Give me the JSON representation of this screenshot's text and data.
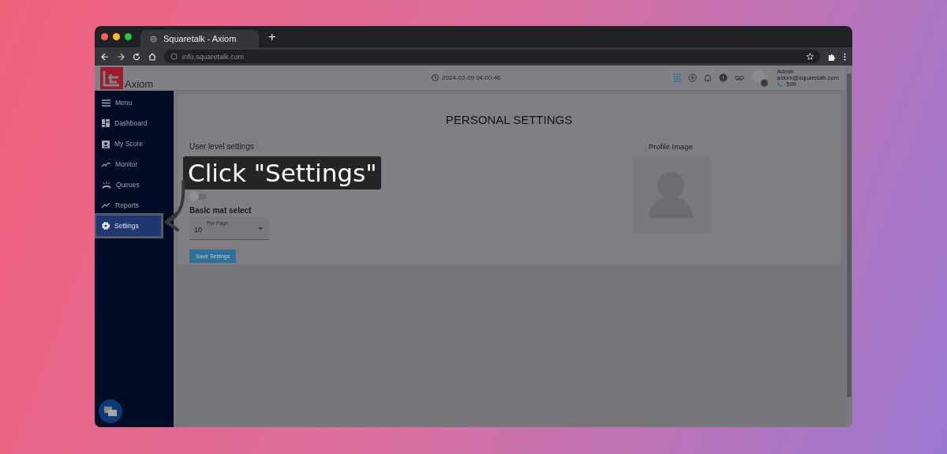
{
  "browser": {
    "tab_title": "Squaretalk - Axiom",
    "new_tab": "+",
    "url": "info.squaretalk.com"
  },
  "header": {
    "logo_text": "Axiom",
    "datetime": "2024-02-09 04:00:46",
    "user": {
      "name": "Admin",
      "email": "axiom@squaretalk.com",
      "extension": "599"
    }
  },
  "sidebar": {
    "items": [
      {
        "label": "Menu",
        "kind": "menu",
        "selected": false
      },
      {
        "label": "Dashboard",
        "kind": "dashboard",
        "selected": false
      },
      {
        "label": "My Score",
        "kind": "score",
        "selected": false
      },
      {
        "label": "Monitor",
        "kind": "monitor",
        "selected": false
      },
      {
        "label": "Queues",
        "kind": "queues",
        "selected": false
      },
      {
        "label": "Reports",
        "kind": "reports",
        "selected": false
      },
      {
        "label": "Settings",
        "kind": "settings",
        "selected": true
      }
    ]
  },
  "page": {
    "title": "PERSONAL SETTINGS",
    "section_title": "User level settings",
    "toggle": {
      "on": false
    },
    "select_section": "Basic mat select",
    "select": {
      "label": "Per Page",
      "value": "10"
    },
    "save_button": "Save Settings",
    "profile_title": "Profile Image"
  },
  "callout": {
    "text": "Click \"Settings\""
  }
}
